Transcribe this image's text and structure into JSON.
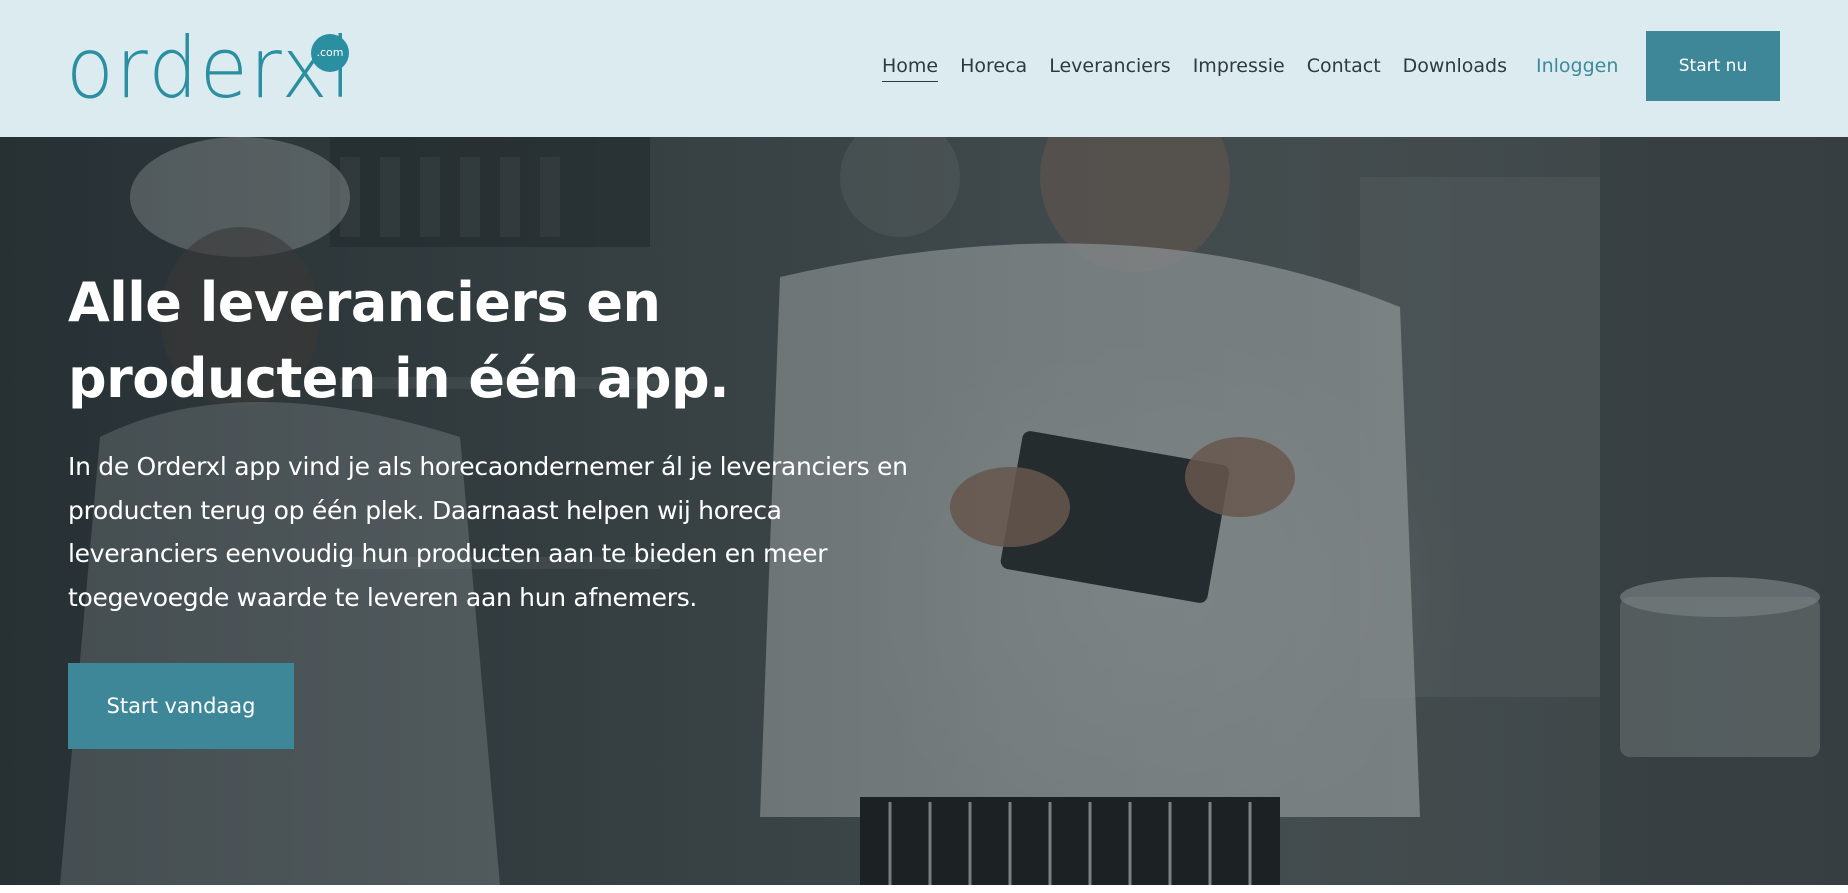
{
  "brand": {
    "logo_text": "orderxl",
    "logo_badge": ".com",
    "logo_color": "#2a8fa0"
  },
  "nav": {
    "items": [
      {
        "label": "Home",
        "active": true
      },
      {
        "label": "Horeca",
        "active": false
      },
      {
        "label": "Leveranciers",
        "active": false
      },
      {
        "label": "Impressie",
        "active": false
      },
      {
        "label": "Contact",
        "active": false
      },
      {
        "label": "Downloads",
        "active": false
      }
    ],
    "login_label": "Inloggen",
    "cta_label": "Start nu"
  },
  "hero": {
    "title": "Alle leveranciers en producten in één app.",
    "text": "In de Orderxl app vind je als horecaondernemer ál je leveranciers en producten terug op één plek. Daarnaast helpen wij horeca leveranciers eenvoudig hun producten aan te bieden en meer toegevoegde waarde te leveren aan hun afnemers.",
    "button_label": "Start vandaag",
    "background_image": "chef-using-tablet-in-kitchen"
  },
  "colors": {
    "header_bg": "#dcebef",
    "accent": "#3e8799",
    "login_link": "#3f8a9c",
    "nav_text": "#2f3a3d"
  }
}
